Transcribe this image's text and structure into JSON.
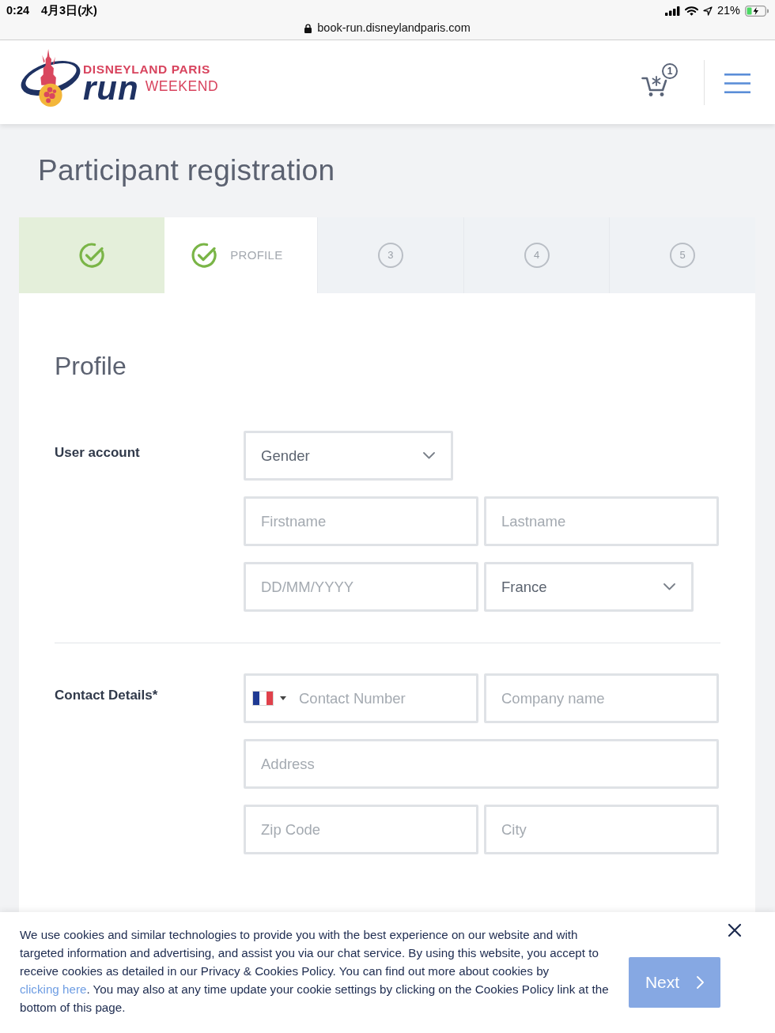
{
  "status_bar": {
    "time": "0:24",
    "date": "4月3日(水)",
    "battery": "21%",
    "url": "book-run.disneylandparis.com"
  },
  "header": {
    "logo": {
      "top": "DISNEYLAND PARIS",
      "large": "run",
      "side": "WEEKEND"
    },
    "cart_count": "1"
  },
  "page_title": "Participant registration",
  "steps": [
    {
      "kind": "done"
    },
    {
      "kind": "current",
      "label": "PROFILE"
    },
    {
      "kind": "upcoming",
      "number": "3"
    },
    {
      "kind": "upcoming",
      "number": "4"
    },
    {
      "kind": "upcoming",
      "number": "5"
    }
  ],
  "form": {
    "title": "Profile",
    "sections": [
      {
        "label": "User account",
        "rows": [
          [
            {
              "kind": "select",
              "placeholder": "Gender"
            }
          ],
          [
            {
              "kind": "text",
              "placeholder": "Firstname"
            },
            {
              "kind": "text",
              "placeholder": "Lastname"
            }
          ],
          [
            {
              "kind": "text",
              "placeholder": "DD/MM/YYYY"
            },
            {
              "kind": "select",
              "value": "France"
            }
          ]
        ]
      },
      {
        "label": "Contact Details*",
        "rows": [
          [
            {
              "kind": "phone",
              "placeholder": "Contact Number"
            },
            {
              "kind": "text",
              "placeholder": "Company name"
            }
          ],
          [
            {
              "kind": "text",
              "placeholder": "Address"
            }
          ],
          [
            {
              "kind": "text",
              "placeholder": "Zip Code"
            },
            {
              "kind": "text",
              "placeholder": "City"
            }
          ]
        ]
      }
    ]
  },
  "next_button": {
    "label": "Next"
  },
  "cookie_banner": {
    "text_before": "We use cookies and similar technologies to provide you with the best experience on our website and with targeted information and advertising, and assist you via our chat service. By using this website, you accept to receive cookies as detailed in our Privacy & Cookies Policy. You can find out more about cookies by ",
    "link": "clicking here",
    "text_after": ". You may also at any time update your cookie settings by clicking on the Cookies Policy link at the bottom of this page."
  }
}
